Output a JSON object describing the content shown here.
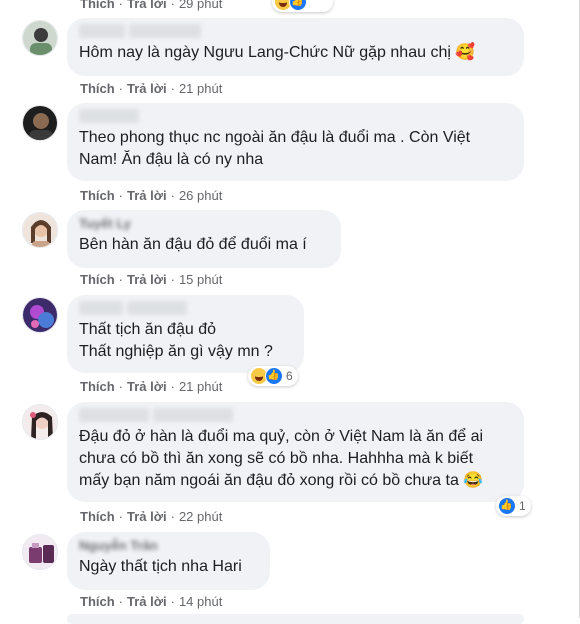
{
  "top_actions": {
    "like": "Thích",
    "reply": "Trả lời",
    "time": "29 phút"
  },
  "comments": [
    {
      "text": "Hôm nay là ngày Ngưu Lang-Chức Nữ gặp nhau chị 🥰",
      "like": "Thích",
      "reply": "Trả lời",
      "time": "21 phút",
      "avatar_color": "#6b8f6a"
    },
    {
      "text": "Theo phong thục nc ngoài ăn đậu là đuổi ma . Còn Việt\nNam! Ăn đậu là có ny nha",
      "like": "Thích",
      "reply": "Trả lời",
      "time": "26 phút",
      "avatar_color": "#2b2b2b"
    },
    {
      "name": "Tuyết Ly",
      "text": "Bên hàn ăn đậu đỏ để đuổi ma í",
      "like": "Thích",
      "reply": "Trả lời",
      "time": "15 phút",
      "avatar_color": "#c9a48a"
    },
    {
      "text": "Thất tịch ăn đậu đỏ\nThất nghiệp ăn gì vậy mn ?",
      "like": "Thích",
      "reply": "Trả lời",
      "time": "21 phút",
      "reaction_count": "6",
      "avatar_color": "#5a3b8c"
    },
    {
      "text": "Đậu đỏ ở hàn là đuổi ma quỷ, còn ở Việt Nam là ăn để ai\nchưa có bồ thì ăn xong sẽ có bồ nha. Hahhha mà k biết\nmấy bạn năm ngoái ăn đậu đỏ xong rồi có bồ chưa ta 😂",
      "like": "Thích",
      "reply": "Trả lời",
      "time": "22 phút",
      "reaction_count": "1",
      "avatar_color": "#d9b7b0"
    },
    {
      "name": "Nguyễn Trân",
      "text": "Ngày thất tịch nha Hari",
      "like": "Thích",
      "reply": "Trả lời",
      "time": "14 phút",
      "avatar_color": "#7a3b6e"
    }
  ]
}
